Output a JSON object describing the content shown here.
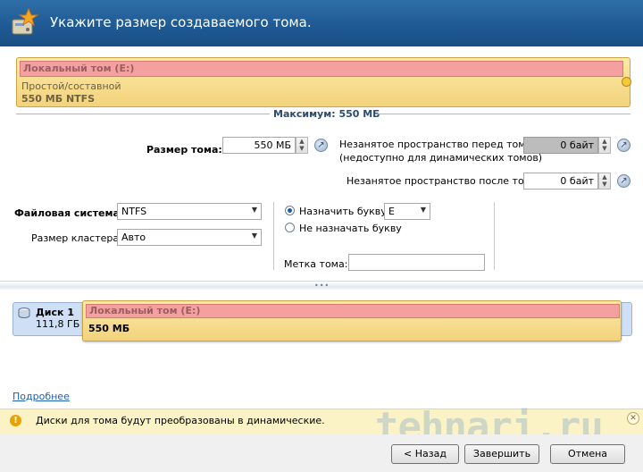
{
  "header": {
    "title": "Укажите размер создаваемого тома."
  },
  "volume_bar": {
    "name": "Локальный том (E:)",
    "type": "Простой/составной",
    "size": "550 МБ NTFS"
  },
  "maximum": {
    "label": "Максимум: 550 МБ"
  },
  "size_field": {
    "label": "Размер тома:",
    "value": "550 МБ"
  },
  "before_field": {
    "label_line1": "Незанятое пространство перед томом:",
    "label_line2": "(недоступно для динамических томов)",
    "value": "0 байт"
  },
  "after_field": {
    "label": "Незанятое пространство после тома:",
    "value": "0 байт"
  },
  "filesystem": {
    "label": "Файловая система:",
    "value": "NTFS"
  },
  "cluster": {
    "label": "Размер кластера:",
    "value": "Авто"
  },
  "letter": {
    "assign_label": "Назначить букву:",
    "letter_value": "E",
    "no_assign_label": "Не назначать букву",
    "assign_selected": true
  },
  "volume_label": {
    "label": "Метка тома:",
    "value": ""
  },
  "disk": {
    "name": "Диск 1",
    "size": "111,8 ГБ",
    "partition_name": "Локальный том (E:)",
    "partition_size": "550 МБ"
  },
  "more_link": "Подробнее",
  "info": {
    "text": "Диски для тома будут преобразованы в динамические."
  },
  "watermark": "tehnari.ru",
  "buttons": {
    "back": "< Назад",
    "finish": "Завершить",
    "cancel": "Отмена"
  },
  "colors": {
    "header": "#1f5a94",
    "volume_fill": "#f3d37c",
    "volume_name_strip": "#f4a0a0",
    "disk_row": "#cfe0f6",
    "info_bar": "#fbf3c5"
  }
}
